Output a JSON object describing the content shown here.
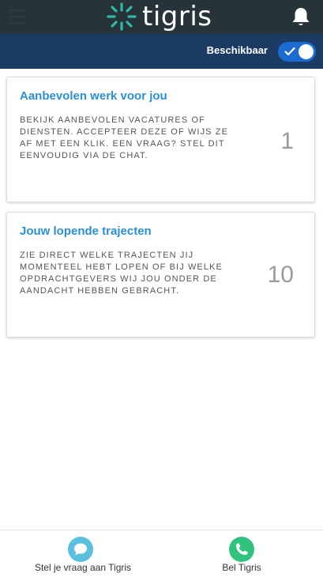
{
  "header": {
    "brand": "tigris",
    "icons": [
      "menu-icon",
      "tigris-logo-icon",
      "bell-icon"
    ]
  },
  "availability": {
    "label": "Beschikbaar",
    "enabled": true
  },
  "cards": [
    {
      "title": "Aanbevolen werk voor jou",
      "description": "Bekijk aanbevolen vacatures of diensten. Accepteer deze of wijs ze af met een klik. Een vraag? Stel dit eenvoudig via de chat.",
      "count": "1"
    },
    {
      "title": "Jouw lopende trajecten",
      "description": "Zie direct welke trajecten jij momenteel hebt lopen of bij welke opdrachtgevers wij jou onder de aandacht hebben gebracht.",
      "count": "10"
    }
  ],
  "bottom_nav": {
    "chat_label": "Stel je vraag aan Tigris",
    "call_label": "Bel Tigris",
    "colors": {
      "chat": "#5bc0de",
      "call": "#2fc37e"
    }
  },
  "colors": {
    "topbar": "#263339",
    "subbar": "#1b3a64",
    "accent": "#2a8fd6",
    "toggle": "#1b6bd1"
  }
}
